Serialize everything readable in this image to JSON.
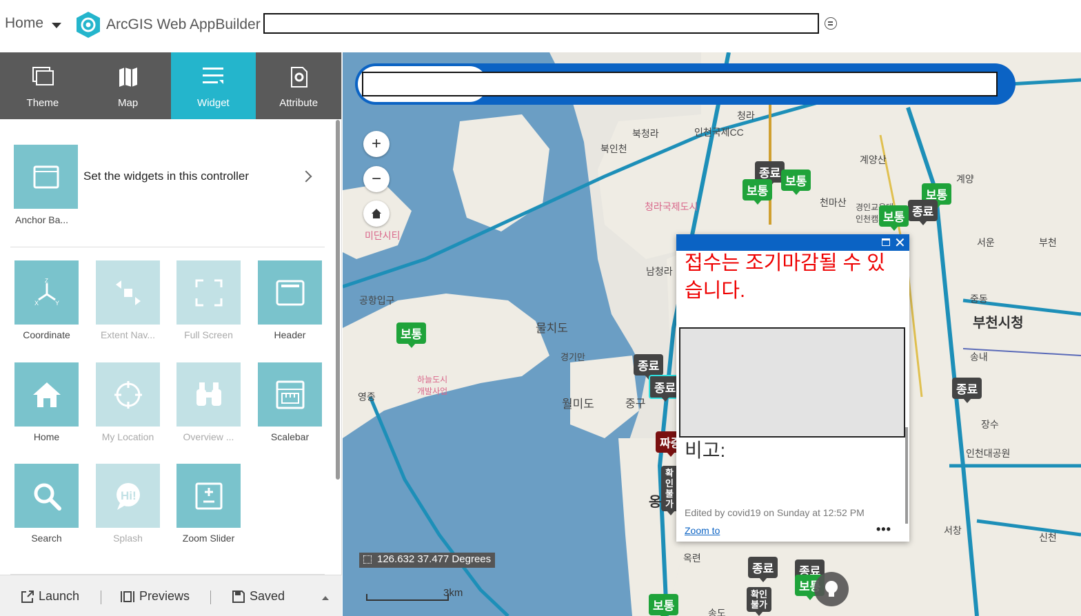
{
  "header": {
    "home_label": "Home",
    "app_title": "ArcGIS Web AppBuilder"
  },
  "tabs": [
    {
      "label": "Theme",
      "icon": "theme-icon"
    },
    {
      "label": "Map",
      "icon": "map-icon"
    },
    {
      "label": "Widget",
      "icon": "widget-icon",
      "active": true
    },
    {
      "label": "Attribute",
      "icon": "attribute-icon"
    }
  ],
  "controller": {
    "tile_label": "Anchor Ba...",
    "description": "Set the widgets in this controller"
  },
  "widgets": [
    {
      "label": "Coordinate",
      "enabled": true,
      "icon": "coordinate-icon"
    },
    {
      "label": "Extent Nav...",
      "enabled": false,
      "icon": "extent-navigate-icon"
    },
    {
      "label": "Full Screen",
      "enabled": false,
      "icon": "full-screen-icon"
    },
    {
      "label": "Header",
      "enabled": true,
      "icon": "header-icon"
    },
    {
      "label": "Home",
      "enabled": true,
      "icon": "home-icon"
    },
    {
      "label": "My Location",
      "enabled": false,
      "icon": "my-location-icon"
    },
    {
      "label": "Overview ...",
      "enabled": false,
      "icon": "binoculars-icon"
    },
    {
      "label": "Scalebar",
      "enabled": true,
      "icon": "scalebar-icon"
    },
    {
      "label": "Search",
      "enabled": true,
      "icon": "search-icon"
    },
    {
      "label": "Splash",
      "enabled": false,
      "icon": "splash-icon"
    },
    {
      "label": "Zoom Slider",
      "enabled": true,
      "icon": "zoom-slider-icon"
    }
  ],
  "footer": {
    "launch": "Launch",
    "previews": "Previews",
    "saved": "Saved"
  },
  "map": {
    "coordinates": "126.632 37.477 Degrees",
    "scale_label": "3km",
    "places": [
      "청라",
      "북청라",
      "인천국제CC",
      "북인천",
      "계양산",
      "계양",
      "천마산",
      "청라국제도시",
      "경인교육대 인천캠퍼스",
      "미단시티",
      "서운",
      "부천",
      "남청라",
      "공항입구",
      "중동",
      "부천시청",
      "물치도",
      "경기만",
      "송내",
      "영종",
      "하늘도시 개발사업",
      "월미도",
      "중구",
      "장수",
      "인천대공원",
      "옹진",
      "옥련",
      "서창",
      "신천",
      "송도"
    ],
    "markers": [
      "종료",
      "보통",
      "보통",
      "보통",
      "종료",
      "보통",
      "보통",
      "종료",
      "종료",
      "종료",
      "종료",
      "짜증",
      "확인불가",
      "확인불가",
      "종료",
      "보통",
      "종료",
      "보통"
    ]
  },
  "popup": {
    "message": "접수는 조기마감될 수 있습니다.",
    "note_label": "비고:",
    "edited": "Edited by covid19 on Sunday at 12:52 PM",
    "zoom_link": "Zoom to",
    "more": "•••"
  },
  "colors": {
    "accent": "#24b5cc",
    "tab_bar": "#5a5a5a",
    "tile": "#7ac3cc",
    "tile_disabled": "#c2e1e5",
    "popup_header": "#0b63c4",
    "alert_text": "#ee0000"
  }
}
